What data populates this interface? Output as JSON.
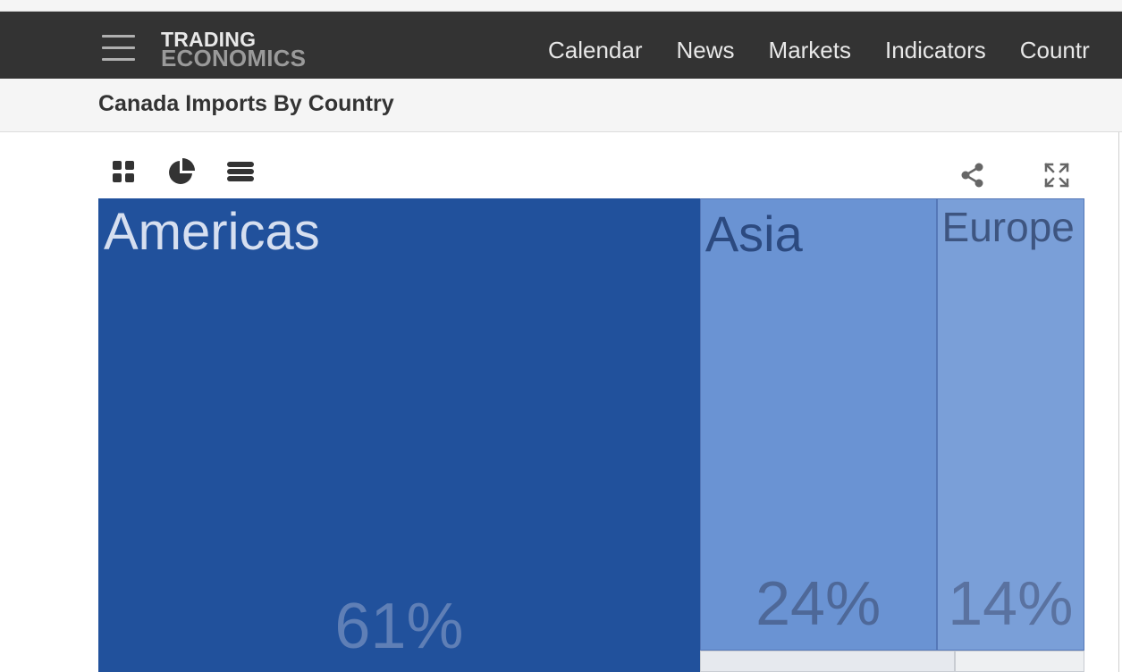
{
  "header": {
    "logo_line1": "TRADING",
    "logo_line2": "ECONOMICS",
    "nav": [
      "Calendar",
      "News",
      "Markets",
      "Indicators",
      "Countr"
    ]
  },
  "page": {
    "title": "Canada Imports By Country"
  },
  "toolbar": {
    "left_icons": [
      "grid-icon",
      "pie-chart-icon",
      "list-icon"
    ],
    "right_icons": [
      "share-icon",
      "expand-icon"
    ]
  },
  "chart_data": {
    "type": "treemap",
    "items": [
      {
        "label": "Americas",
        "percent_label": "61%",
        "value": 61,
        "color": "#21519c"
      },
      {
        "label": "Asia",
        "percent_label": "24%",
        "value": 24,
        "color": "#6a93d3"
      },
      {
        "label": "Europe",
        "percent_label": "14%",
        "value": 14,
        "color": "#7a9fd8"
      }
    ]
  },
  "colors": {
    "navbar": "#333333",
    "title_bar": "#f5f5f5",
    "icon": "#333333"
  }
}
